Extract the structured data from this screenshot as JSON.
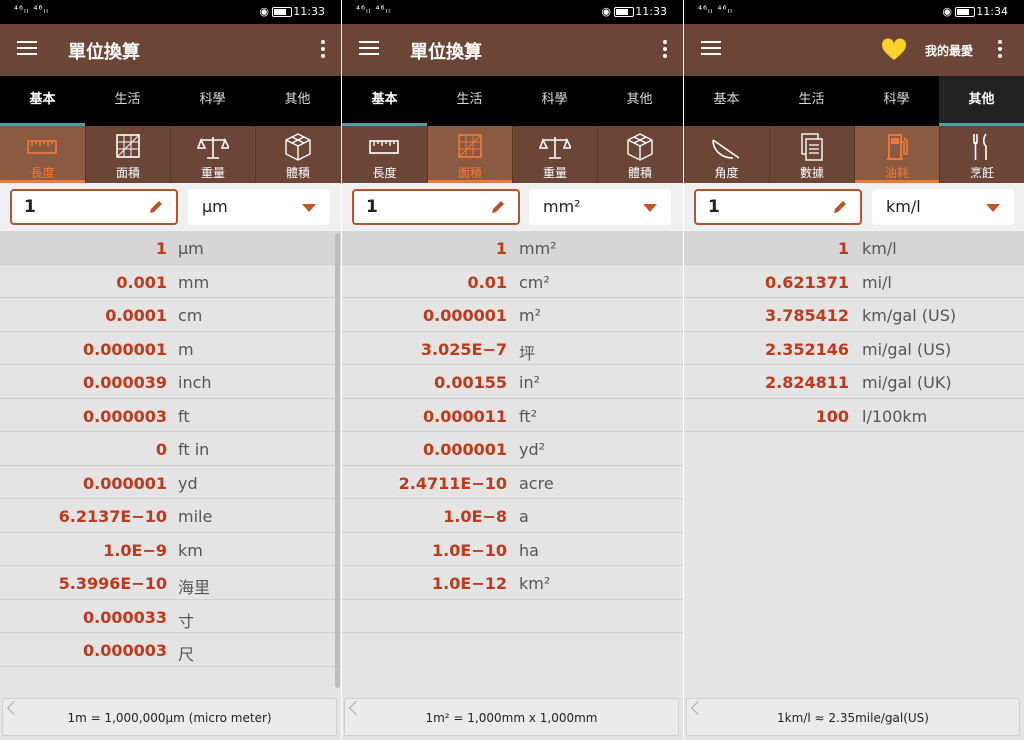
{
  "colors": {
    "appbar": "#6b4636",
    "accent": "#f17a3a",
    "value_red": "#c0391b",
    "tab_indicator": "#4f9fa8",
    "heart": "#f5d328"
  },
  "panels": [
    {
      "status": {
        "left": "⁴⁶ₗₗ ⁴⁶ₗₗ",
        "time": "11:33"
      },
      "title": "單位換算",
      "tabs": [
        "基本",
        "生活",
        "科學",
        "其他"
      ],
      "active_tab": 0,
      "categories": [
        {
          "label": "長度",
          "icon": "ruler-icon"
        },
        {
          "label": "面積",
          "icon": "area-grid-icon"
        },
        {
          "label": "重量",
          "icon": "scale-icon"
        },
        {
          "label": "體積",
          "icon": "cube-icon"
        }
      ],
      "active_category": 0,
      "input": {
        "value": "1",
        "unit": "μm"
      },
      "results": [
        {
          "v": "1",
          "u": "μm"
        },
        {
          "v": "0.001",
          "u": "mm"
        },
        {
          "v": "0.0001",
          "u": "cm"
        },
        {
          "v": "0.000001",
          "u": "m"
        },
        {
          "v": "0.000039",
          "u": "inch"
        },
        {
          "v": "0.000003",
          "u": "ft"
        },
        {
          "v": "0",
          "u": "ft in"
        },
        {
          "v": "0.000001",
          "u": "yd"
        },
        {
          "v": "6.2137E−10",
          "u": "mile"
        },
        {
          "v": "1.0E−9",
          "u": "km"
        },
        {
          "v": "5.3996E−10",
          "u": "海里"
        },
        {
          "v": "0.000033",
          "u": "寸"
        },
        {
          "v": "0.000003",
          "u": "尺"
        }
      ],
      "footer": "1m = 1,000,000μm (micro meter)"
    },
    {
      "status": {
        "left": "⁴⁶ₗₗ ⁴⁶ₗₗ",
        "time": "11:33"
      },
      "title": "單位換算",
      "tabs": [
        "基本",
        "生活",
        "科學",
        "其他"
      ],
      "active_tab": 0,
      "categories": [
        {
          "label": "長度",
          "icon": "ruler-icon"
        },
        {
          "label": "面積",
          "icon": "area-grid-icon"
        },
        {
          "label": "重量",
          "icon": "scale-icon"
        },
        {
          "label": "體積",
          "icon": "cube-icon"
        }
      ],
      "active_category": 1,
      "input": {
        "value": "1",
        "unit": "mm²"
      },
      "results": [
        {
          "v": "1",
          "u": "mm²"
        },
        {
          "v": "0.01",
          "u": "cm²"
        },
        {
          "v": "0.000001",
          "u": "m²"
        },
        {
          "v": "3.025E−7",
          "u": "坪"
        },
        {
          "v": "0.00155",
          "u": "in²"
        },
        {
          "v": "0.000011",
          "u": "ft²"
        },
        {
          "v": "0.000001",
          "u": "yd²"
        },
        {
          "v": "2.4711E−10",
          "u": "acre"
        },
        {
          "v": "1.0E−8",
          "u": "a"
        },
        {
          "v": "1.0E−10",
          "u": "ha"
        },
        {
          "v": "1.0E−12",
          "u": "km²"
        }
      ],
      "footer": "1m² = 1,000mm x 1,000mm"
    },
    {
      "status": {
        "left": "⁴⁶ₗₗ ⁴⁶ₗₗ",
        "time": "11:34"
      },
      "fav_label": "我的最愛",
      "tabs": [
        "基本",
        "生活",
        "科學",
        "其他"
      ],
      "active_tab": 3,
      "categories": [
        {
          "label": "角度",
          "icon": "angle-icon"
        },
        {
          "label": "數據",
          "icon": "documents-icon"
        },
        {
          "label": "油耗",
          "icon": "fuel-pump-icon"
        },
        {
          "label": "烹飪",
          "icon": "utensils-icon"
        }
      ],
      "active_category": 2,
      "input": {
        "value": "1",
        "unit": "km/l"
      },
      "results": [
        {
          "v": "1",
          "u": "km/l"
        },
        {
          "v": "0.621371",
          "u": "mi/l"
        },
        {
          "v": "3.785412",
          "u": "km/gal (US)"
        },
        {
          "v": "2.352146",
          "u": "mi/gal (US)"
        },
        {
          "v": "2.824811",
          "u": "mi/gal (UK)"
        },
        {
          "v": "100",
          "u": "l/100km"
        }
      ],
      "footer": "1km/l ≈ 2.35mile/gal(US)"
    }
  ]
}
